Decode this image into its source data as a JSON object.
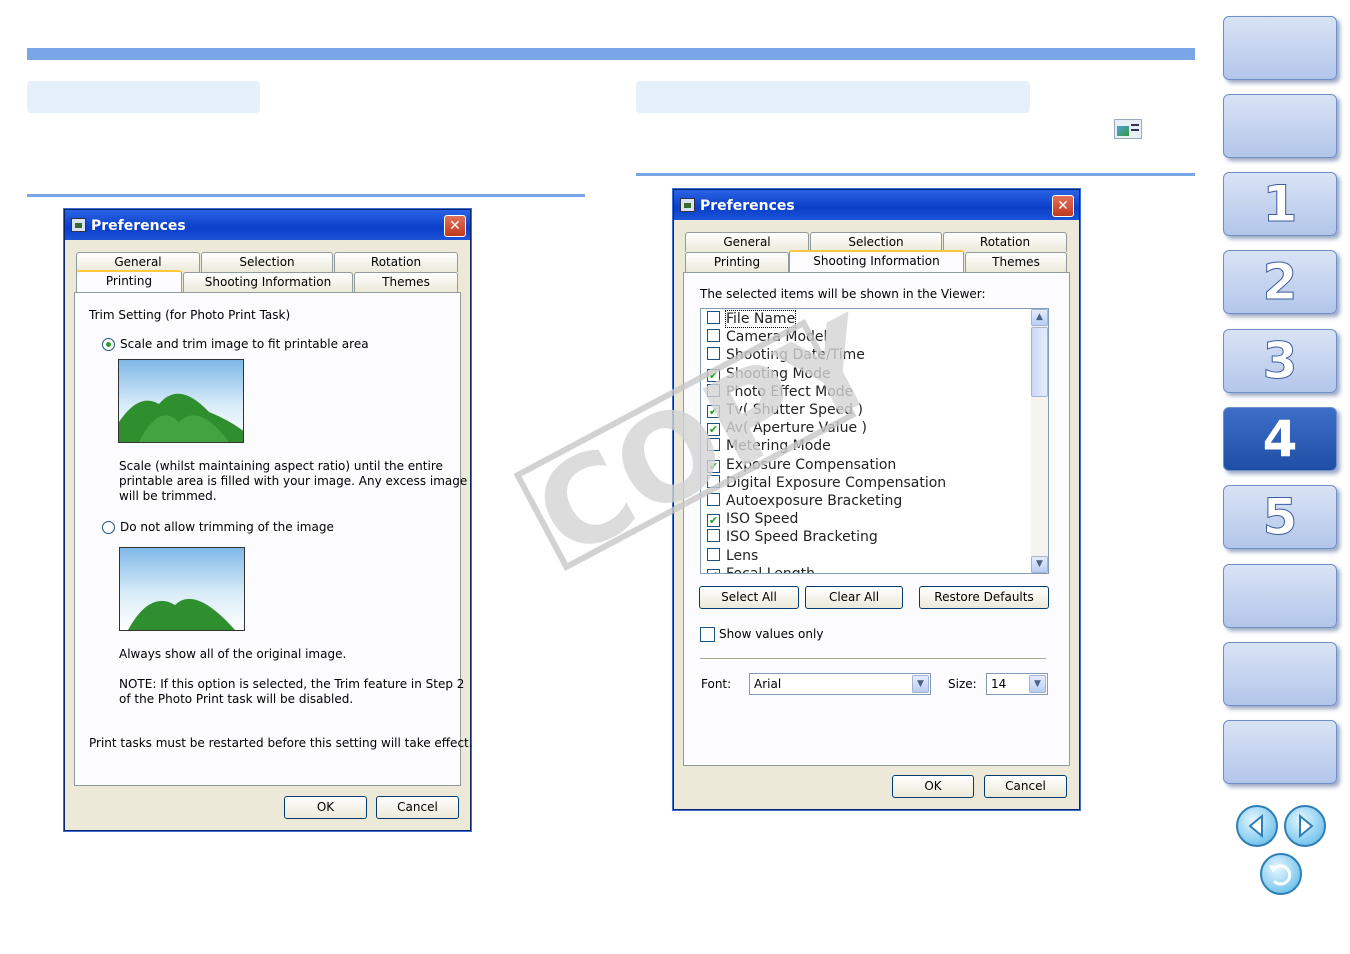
{
  "watermark": "COPY",
  "left_dialog": {
    "title": "Preferences",
    "tabs_row1": [
      "General",
      "Selection",
      "Rotation"
    ],
    "tabs_row2": [
      "Printing",
      "Shooting Information",
      "Themes"
    ],
    "active_tab": "Printing",
    "trim_heading": "Trim Setting (for Photo Print Task)",
    "option1_label": "Scale and trim image to fit printable area",
    "option1_desc": [
      "Scale (whilst maintaining aspect ratio) until the entire",
      "printable area is filled with your image. Any excess image",
      "will be trimmed."
    ],
    "option2_label": "Do not allow trimming of the image",
    "option2_desc": "Always show all of the original image.",
    "note": [
      "NOTE: If this option is selected, the Trim feature in Step 2",
      "of the Photo Print task will be disabled."
    ],
    "restart_note": "Print tasks must be restarted before this setting will take effect.",
    "ok": "OK",
    "cancel": "Cancel"
  },
  "right_dialog": {
    "title": "Preferences",
    "tabs_row1": [
      "General",
      "Selection",
      "Rotation"
    ],
    "tabs_row2": [
      "Printing",
      "Shooting Information",
      "Themes"
    ],
    "active_tab": "Shooting Information",
    "instruction": "The selected items will be shown in the Viewer:",
    "items": [
      {
        "label": "File Name",
        "checked": false
      },
      {
        "label": "Camera Model",
        "checked": false
      },
      {
        "label": "Shooting Date/Time",
        "checked": false
      },
      {
        "label": "Shooting Mode",
        "checked": true
      },
      {
        "label": "Photo Effect Mode",
        "checked": false
      },
      {
        "label": "Tv( Shutter Speed )",
        "checked": true
      },
      {
        "label": "Av( Aperture Value )",
        "checked": true
      },
      {
        "label": "Metering Mode",
        "checked": false
      },
      {
        "label": "Exposure Compensation",
        "checked": true
      },
      {
        "label": "Digital Exposure Compensation",
        "checked": false
      },
      {
        "label": "Autoexposure Bracketing",
        "checked": false
      },
      {
        "label": "ISO Speed",
        "checked": true
      },
      {
        "label": "ISO Speed Bracketing",
        "checked": false
      },
      {
        "label": "Lens",
        "checked": false
      },
      {
        "label": "Focal Length",
        "checked": true
      }
    ],
    "select_all": "Select All",
    "clear_all": "Clear All",
    "restore_defaults": "Restore Defaults",
    "show_values_only": "Show values only",
    "font_label": "Font:",
    "font_value": "Arial",
    "size_label": "Size:",
    "size_value": "14",
    "ok": "OK",
    "cancel": "Cancel"
  },
  "side_nav": [
    "",
    "",
    "1",
    "2",
    "3",
    "4",
    "5",
    "",
    ""
  ],
  "side_nav_active": "4",
  "colors": {
    "accent": "#7aa6e8",
    "nav_active": "#2a58b0",
    "xp_title": "#0a3ec8"
  }
}
